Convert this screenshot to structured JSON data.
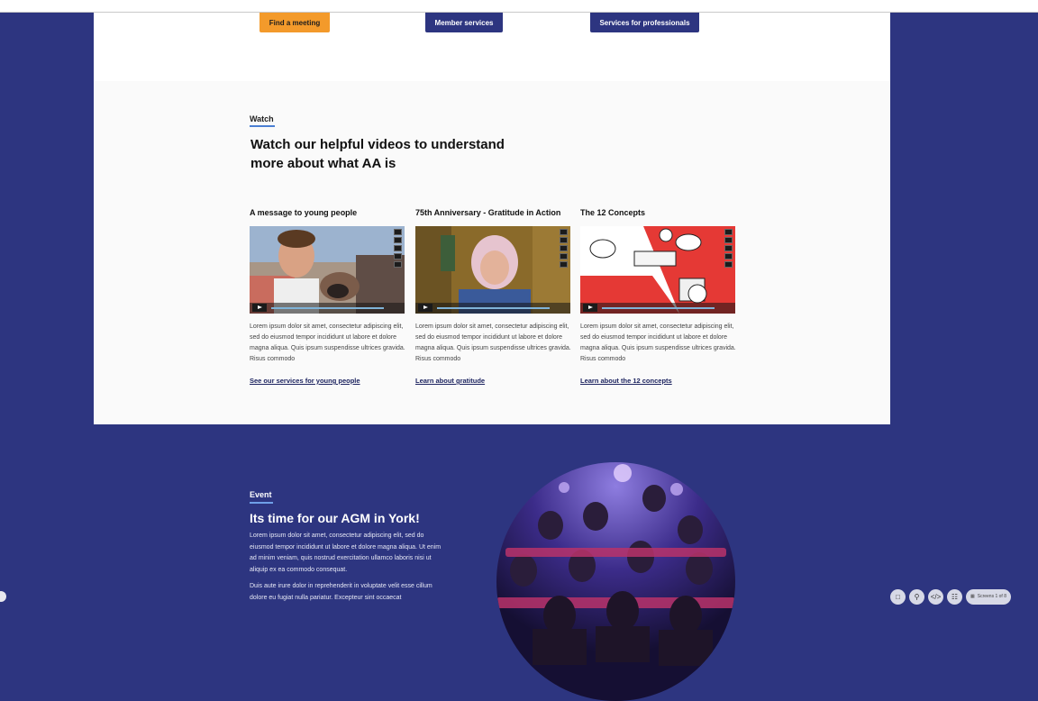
{
  "buttons": {
    "find_meeting": "Find a meeting",
    "member_services": "Member services",
    "services_professionals": "Services for professionals"
  },
  "watch": {
    "eyebrow": "Watch",
    "title_line1": "Watch our helpful videos to understand",
    "title_line2": "more about what AA is",
    "body_text": "Lorem ipsum dolor sit amet, consectetur adipiscing elit, sed do eiusmod tempor incididunt ut labore et dolore magna aliqua. Quis ipsum suspendisse ultrices gravida. Risus commodo",
    "videos": [
      {
        "title": "A message to young people",
        "link": "See our services for young people"
      },
      {
        "title": "75th Anniversary - Gratitude in Action",
        "link": "Learn about gratitude"
      },
      {
        "title": "The 12 Concepts",
        "link": "Learn about the 12 concepts"
      }
    ]
  },
  "event": {
    "eyebrow": "Event",
    "title": "Its time for our AGM in York!",
    "para1": "Lorem ipsum dolor sit amet, consectetur adipiscing elit, sed do eiusmod tempor incididunt ut labore et dolore magna aliqua. Ut enim ad minim veniam, quis nostrud exercitation ullamco laboris nisi ut aliquip ex ea commodo consequat.",
    "para2": "Duis aute irure dolor in reprehenderit in voluptate velit esse cillum dolore eu fugiat nulla pariatur. Excepteur sint occaecat"
  },
  "toolbar": {
    "icons": [
      "comment-icon",
      "search-icon",
      "code-icon",
      "sitemap-icon",
      "grid-icon"
    ],
    "screens_label": "Screens 1 of 8"
  },
  "colors": {
    "brand_navy": "#2d3580",
    "accent_orange": "#f39a2b",
    "link_blue": "#4b7fd3"
  }
}
